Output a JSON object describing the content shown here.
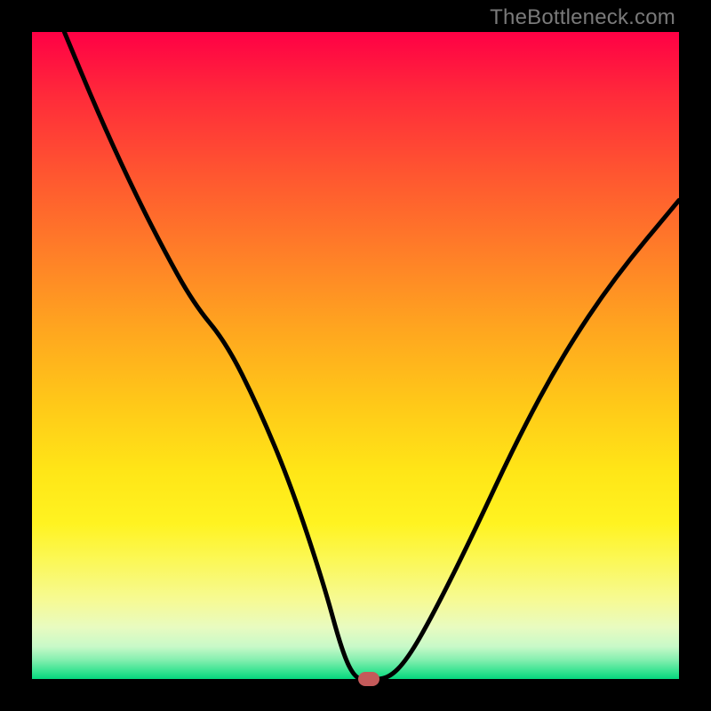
{
  "watermark": "TheBottleneck.com",
  "colors": {
    "frame": "#000000",
    "gradient_top": "#ff0045",
    "gradient_bottom": "#05d67d",
    "curve": "#000000",
    "marker": "#c45a5a"
  },
  "chart_data": {
    "type": "line",
    "title": "",
    "xlabel": "",
    "ylabel": "",
    "xlim": [
      0,
      100
    ],
    "ylim": [
      0,
      100
    ],
    "grid": false,
    "legend": false,
    "series": [
      {
        "name": "bottleneck-curve",
        "x": [
          5,
          10,
          15,
          20,
          25,
          30,
          35,
          40,
          45,
          48,
          50,
          52,
          55,
          58,
          62,
          68,
          75,
          82,
          90,
          100
        ],
        "y": [
          100,
          88,
          77,
          67,
          58,
          52,
          42,
          30,
          15,
          4,
          0,
          0,
          0,
          3,
          10,
          22,
          37,
          50,
          62,
          74
        ]
      }
    ],
    "marker": {
      "x": 52,
      "y": 0
    },
    "notes": "x is relative horizontal position (0=left edge of plot, 100=right). y is bottleneck percentage (0=bottom/green, 100=top/red). Values estimated from pixel positions; chart has no visible axis ticks or labels."
  }
}
